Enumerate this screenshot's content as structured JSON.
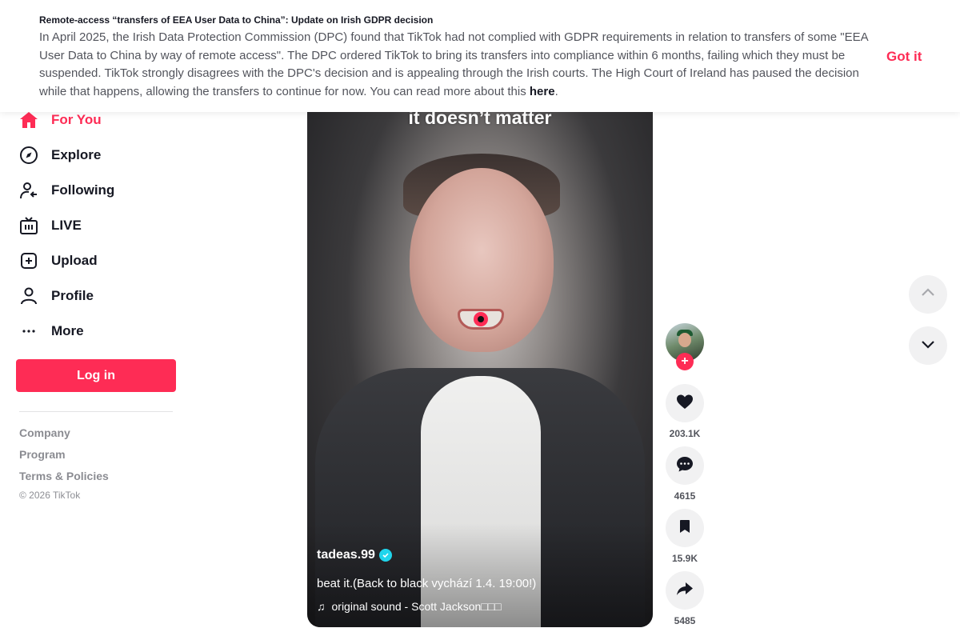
{
  "banner": {
    "title": "Remote-access “transfers of EEA User Data to China”: Update on Irish GDPR decision",
    "body": "In April 2025, the Irish Data Protection Commission (DPC) found that TikTok had not complied with GDPR requirements in relation to transfers of some \"EEA User Data to China by way of remote access\". The DPC ordered TikTok to bring its transfers into compliance within 6 months, failing which they must be suspended. TikTok strongly disagrees with the DPC's decision and is appealing through the Irish courts. The High Court of Ireland has paused the decision while that happens, allowing the transfers to continue for now. You can read more about this ",
    "link_text": "here",
    "after_link": ".",
    "button_label": "Got it"
  },
  "sidebar": {
    "items": [
      {
        "label": "For You",
        "icon": "home-icon",
        "active": true
      },
      {
        "label": "Explore",
        "icon": "compass-icon"
      },
      {
        "label": "Following",
        "icon": "following-icon"
      },
      {
        "label": "LIVE",
        "icon": "live-icon"
      },
      {
        "label": "Upload",
        "icon": "upload-icon"
      },
      {
        "label": "Profile",
        "icon": "profile-icon"
      },
      {
        "label": "More",
        "icon": "more-icon"
      }
    ],
    "login_label": "Log in",
    "footer_links": [
      "Company",
      "Program",
      "Terms & Policies"
    ],
    "copyright": "© 2026 TikTok"
  },
  "video": {
    "overlay_text": "it doesn’t matter",
    "author": "tadeas.99",
    "description": "beat it.(Back to black vychází 1.4. 19:00!)",
    "music": "original sound - Scott Jackson□□□"
  },
  "actions": {
    "likes": "203.1K",
    "comments": "4615",
    "saves": "15.9K",
    "shares": "5485"
  },
  "colors": {
    "accent": "#fe2c55",
    "verified": "#20d5ec"
  }
}
